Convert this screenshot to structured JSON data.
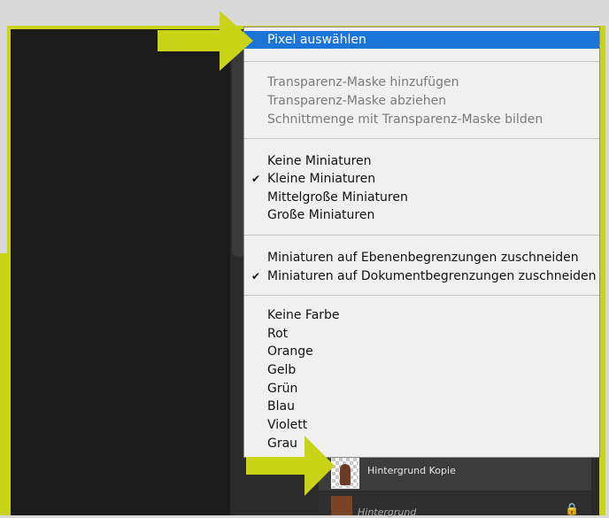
{
  "context_menu": {
    "group1": {
      "select_pixels": "Pixel auswählen"
    },
    "group2": {
      "add_mask": "Transparenz-Maske hinzufügen",
      "subtract_mask": "Transparenz-Maske abziehen",
      "intersect_mask": "Schnittmenge mit Transparenz-Maske bilden"
    },
    "group3": {
      "no_thumbs": "Keine Miniaturen",
      "small_thumbs": "Kleine Miniaturen",
      "medium_thumbs": "Mittelgroße Miniaturen",
      "large_thumbs": "Große Miniaturen"
    },
    "group4": {
      "clip_layer": "Miniaturen auf Ebenenbegrenzungen zuschneiden",
      "clip_document": "Miniaturen auf Dokumentbegrenzungen zuschneiden"
    },
    "group5": {
      "no_color": "Keine Farbe",
      "red": "Rot",
      "orange": "Orange",
      "yellow": "Gelb",
      "green": "Grün",
      "blue": "Blau",
      "violet": "Violett",
      "gray": "Grau"
    },
    "checkmark": "✔"
  },
  "layers": {
    "layer1_name": "Hintergrund Kopie",
    "layer2_name": "Hintergrund"
  },
  "colors": {
    "highlight": "#1b74d8",
    "frame_accent": "#c9d416"
  }
}
